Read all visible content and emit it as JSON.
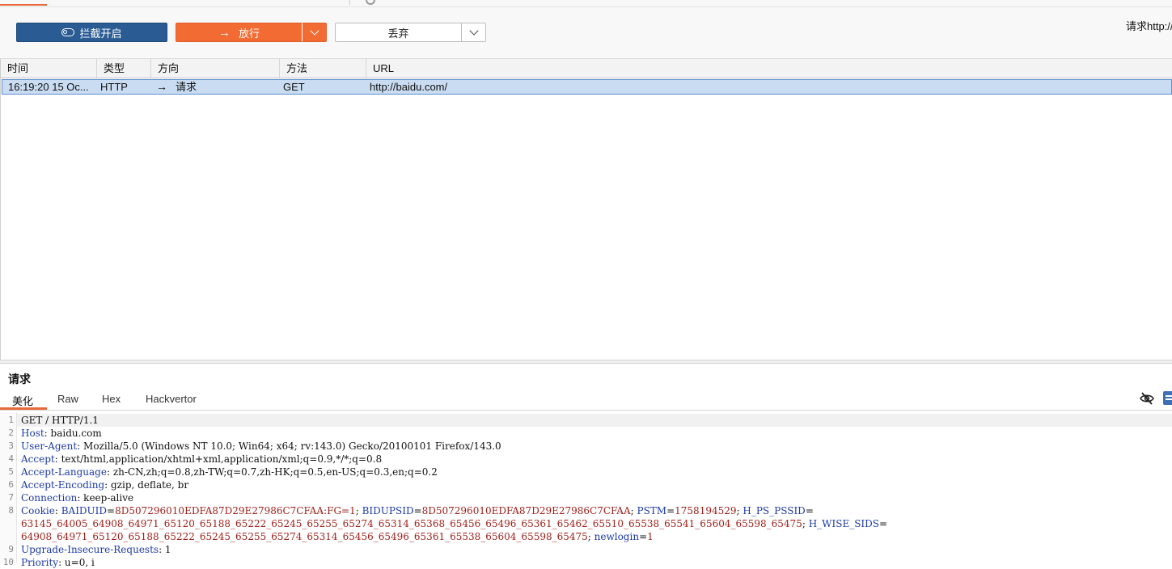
{
  "toolbar": {
    "intercept_label": "拦截开启",
    "forward_label": "放行",
    "drop_label": "丢弃",
    "request_info": "请求http://",
    "icons": {
      "intercept": "toggle-icon",
      "forward": "arrow-right-icon",
      "dropdown": "chevron-down-icon"
    }
  },
  "table": {
    "columns": [
      "时间",
      "类型",
      "方向",
      "方法",
      "URL"
    ],
    "rows": [
      {
        "time": "16:19:20 15 Oc...",
        "type": "HTTP",
        "direction_arrow": "→",
        "direction": "请求",
        "method": "GET",
        "url": "http://baidu.com/"
      }
    ]
  },
  "panel": {
    "title": "请求",
    "tabs": [
      "美化",
      "Raw",
      "Hex",
      "Hackvertor"
    ]
  },
  "editor": {
    "lines": [
      {
        "n": "1",
        "parts": [
          {
            "t": "GET / HTTP/1.1",
            "c": "hv"
          }
        ]
      },
      {
        "n": "2",
        "parts": [
          {
            "t": "Host",
            "c": "hk"
          },
          {
            "t": ": baidu.com",
            "c": "hv"
          }
        ]
      },
      {
        "n": "3",
        "parts": [
          {
            "t": "User-Agent",
            "c": "hk"
          },
          {
            "t": ": Mozilla/5.0 (Windows NT 10.0; Win64; x64; rv:143.0) Gecko/20100101 Firefox/143.0",
            "c": "hv"
          }
        ]
      },
      {
        "n": "4",
        "parts": [
          {
            "t": "Accept",
            "c": "hk"
          },
          {
            "t": ": text/html,application/xhtml+xml,application/xml;q=0.9,*/*;q=0.8",
            "c": "hv"
          }
        ]
      },
      {
        "n": "5",
        "parts": [
          {
            "t": "Accept-Language",
            "c": "hk"
          },
          {
            "t": ": zh-CN,zh;q=0.8,zh-TW;q=0.7,zh-HK;q=0.5,en-US;q=0.3,en;q=0.2",
            "c": "hv"
          }
        ]
      },
      {
        "n": "6",
        "parts": [
          {
            "t": "Accept-Encoding",
            "c": "hk"
          },
          {
            "t": ": gzip, deflate, br",
            "c": "hv"
          }
        ]
      },
      {
        "n": "7",
        "parts": [
          {
            "t": "Connection",
            "c": "hk"
          },
          {
            "t": ": keep-alive",
            "c": "hv"
          }
        ]
      },
      {
        "n": "8",
        "parts": [
          {
            "t": "Cookie",
            "c": "hk"
          },
          {
            "t": ": ",
            "c": "hv"
          },
          {
            "t": "BAIDUID",
            "c": "ck"
          },
          {
            "t": "=",
            "c": "hv"
          },
          {
            "t": "8D507296010EDFA87D29E27986C7CFAA:FG=1",
            "c": "cv"
          },
          {
            "t": "; ",
            "c": "hv"
          },
          {
            "t": "BIDUPSID",
            "c": "ck"
          },
          {
            "t": "=",
            "c": "hv"
          },
          {
            "t": "8D507296010EDFA87D29E27986C7CFAA",
            "c": "cv"
          },
          {
            "t": "; ",
            "c": "hv"
          },
          {
            "t": "PSTM",
            "c": "ck"
          },
          {
            "t": "=",
            "c": "hv"
          },
          {
            "t": "1758194529",
            "c": "cv"
          },
          {
            "t": "; ",
            "c": "hv"
          },
          {
            "t": "H_PS_PSSID",
            "c": "ck"
          },
          {
            "t": "=",
            "c": "hv"
          }
        ]
      },
      {
        "n": "",
        "parts": [
          {
            "t": "63145_64005_64908_64971_65120_65188_65222_65245_65255_65274_65314_65368_65456_65496_65361_65462_65510_65538_65541_65604_65598_65475",
            "c": "cv"
          },
          {
            "t": "; ",
            "c": "hv"
          },
          {
            "t": "H_WISE_SIDS",
            "c": "ck"
          },
          {
            "t": "=",
            "c": "hv"
          }
        ]
      },
      {
        "n": "",
        "parts": [
          {
            "t": "64908_64971_65120_65188_65222_65245_65255_65274_65314_65456_65496_65361_65538_65604_65598_65475",
            "c": "cv"
          },
          {
            "t": "; ",
            "c": "hv"
          },
          {
            "t": "newlogin",
            "c": "ck"
          },
          {
            "t": "=",
            "c": "hv"
          },
          {
            "t": "1",
            "c": "cv"
          }
        ]
      },
      {
        "n": "9",
        "parts": [
          {
            "t": "Upgrade-Insecure-Requests",
            "c": "hk"
          },
          {
            "t": ": 1",
            "c": "hv"
          }
        ]
      },
      {
        "n": "10",
        "parts": [
          {
            "t": "Priority",
            "c": "hk"
          },
          {
            "t": ": u=0, i",
            "c": "hv"
          }
        ]
      }
    ]
  },
  "colors": {
    "accent": "#f26b33",
    "primary": "#2a5b92",
    "selection": "#c9dcf2",
    "header_key": "#1c3aa5",
    "cookie_value": "#a0201a"
  }
}
